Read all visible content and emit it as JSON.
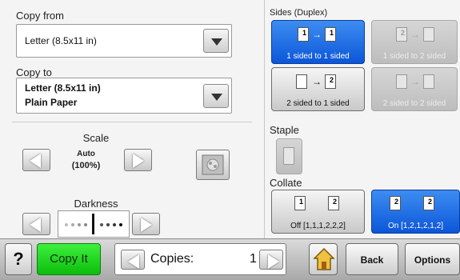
{
  "copy_from": {
    "label": "Copy from",
    "value": "Letter (8.5x11 in)"
  },
  "copy_to": {
    "label": "Copy to",
    "value_line1": "Letter (8.5x11 in)",
    "value_line2": "Plain Paper"
  },
  "scale": {
    "label": "Scale",
    "value_line1": "Auto",
    "value_line2": "(100%)"
  },
  "darkness": {
    "label": "Darkness",
    "level": 5,
    "max": 9
  },
  "sides": {
    "label": "Sides (Duplex)",
    "options": [
      {
        "label": "1 sided to 1 sided",
        "state": "selected"
      },
      {
        "label": "1 sided to 2 sided",
        "state": "disabled"
      },
      {
        "label": "2 sided to 1 sided",
        "state": "normal"
      },
      {
        "label": "2 sided to 2 sided",
        "state": "disabled"
      }
    ]
  },
  "staple": {
    "label": "Staple"
  },
  "collate": {
    "label": "Collate",
    "options": [
      {
        "label": "Off [1,1,1,2,2,2]",
        "state": "normal"
      },
      {
        "label": "On [1,2,1,2,1,2]",
        "state": "selected"
      }
    ]
  },
  "bottom": {
    "help_label": "?",
    "copy_it_label": "Copy It",
    "copies_label": "Copies:",
    "copies_value": "1",
    "back_label": "Back",
    "options_label": "Options"
  },
  "colors": {
    "selected_blue": "#1a6ae6",
    "copy_it_green": "#22d622"
  }
}
